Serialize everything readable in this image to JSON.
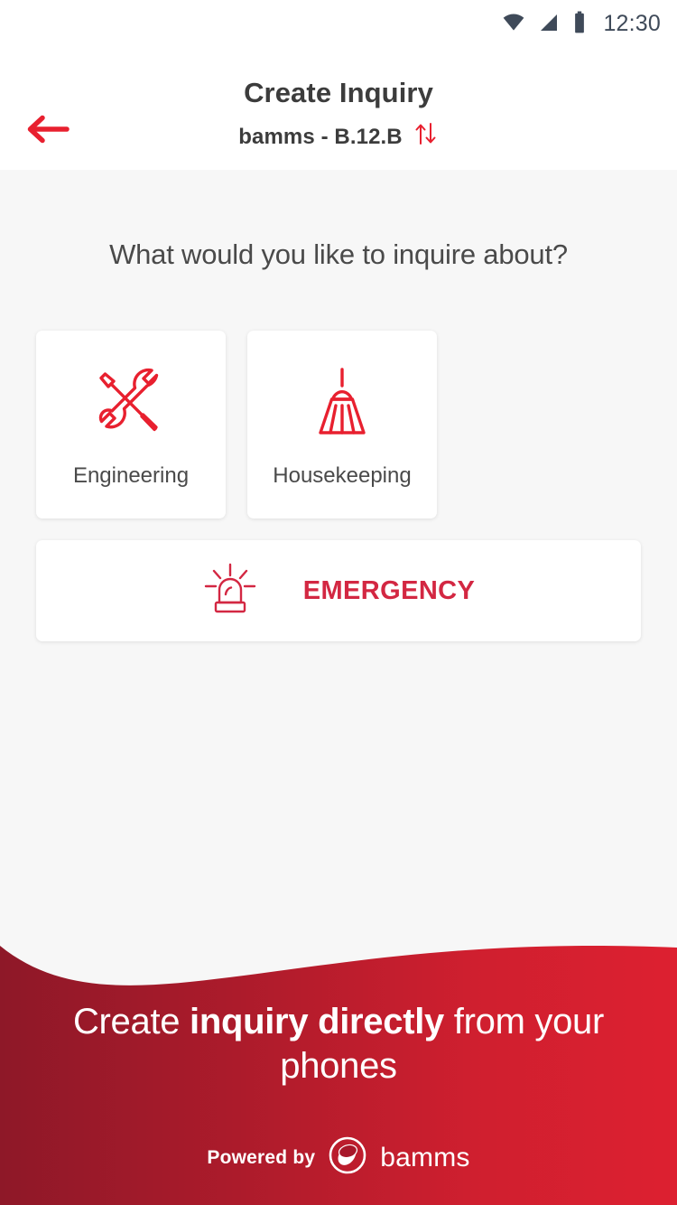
{
  "status_bar": {
    "time": "12:30",
    "icons": [
      "wifi-icon",
      "cellular-signal-icon",
      "battery-icon"
    ]
  },
  "app_bar": {
    "back_icon": "arrow-left-icon",
    "title": "Create Inquiry",
    "subtitle": "bamms - B.12.B",
    "swap_icon": "swap-vertical-icon"
  },
  "main": {
    "question": "What would you like to inquire about?",
    "categories": [
      {
        "label": "Engineering",
        "icon": "tools-icon"
      },
      {
        "label": "Housekeeping",
        "icon": "broom-icon"
      }
    ],
    "emergency": {
      "label": "EMERGENCY",
      "icon": "siren-icon"
    }
  },
  "banner": {
    "headline_part1": "Create ",
    "headline_bold": "inquiry directly",
    "headline_part2": " from your phones",
    "powered_by": "Powered by",
    "brand": "bamms",
    "logo_icon": "bamms-logo-icon"
  },
  "colors": {
    "accent_red": "#e8202f",
    "emergency_red": "#d32742",
    "banner_gradient_start": "#93192a",
    "banner_gradient_end": "#dd2030",
    "text_dark": "#3c3c3c",
    "text_body": "#4a4a4a",
    "page_background": "#f7f7f7",
    "status_icon": "#3f4a59"
  }
}
